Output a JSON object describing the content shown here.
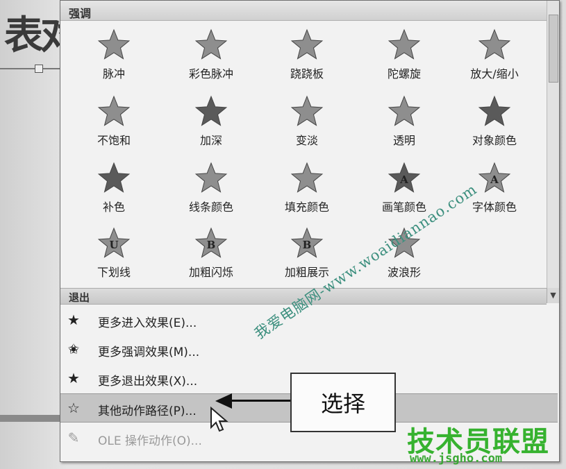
{
  "background": {
    "title_fragment": "表对"
  },
  "menu": {
    "emphasis_header": "强调",
    "effects": [
      {
        "label": "脉冲",
        "icon": "star-pulse-icon",
        "glyph": ""
      },
      {
        "label": "彩色脉冲",
        "icon": "star-color-pulse-icon",
        "glyph": ""
      },
      {
        "label": "跷跷板",
        "icon": "star-teeter-icon",
        "glyph": ""
      },
      {
        "label": "陀螺旋",
        "icon": "star-spin-icon",
        "glyph": ""
      },
      {
        "label": "放大/缩小",
        "icon": "star-grow-shrink-icon",
        "glyph": ""
      },
      {
        "label": "不饱和",
        "icon": "star-desaturate-icon",
        "glyph": ""
      },
      {
        "label": "加深",
        "icon": "star-darken-icon",
        "glyph": ""
      },
      {
        "label": "变淡",
        "icon": "star-lighten-icon",
        "glyph": ""
      },
      {
        "label": "透明",
        "icon": "star-transparency-icon",
        "glyph": ""
      },
      {
        "label": "对象颜色",
        "icon": "star-object-color-icon",
        "glyph": ""
      },
      {
        "label": "补色",
        "icon": "star-complementary-color-icon",
        "glyph": ""
      },
      {
        "label": "线条颜色",
        "icon": "star-line-color-icon",
        "glyph": ""
      },
      {
        "label": "填充颜色",
        "icon": "star-fill-color-icon",
        "glyph": ""
      },
      {
        "label": "画笔颜色",
        "icon": "star-brush-color-icon",
        "glyph": "A"
      },
      {
        "label": "字体颜色",
        "icon": "star-font-color-icon",
        "glyph": "A"
      },
      {
        "label": "下划线",
        "icon": "star-underline-icon",
        "glyph": "U"
      },
      {
        "label": "加粗闪烁",
        "icon": "star-bold-flash-icon",
        "glyph": "B"
      },
      {
        "label": "加粗展示",
        "icon": "star-bold-reveal-icon",
        "glyph": "B"
      },
      {
        "label": "波浪形",
        "icon": "star-wave-icon",
        "glyph": ""
      }
    ],
    "exit_header": "退出",
    "commands": [
      {
        "label": "更多进入效果(E)...",
        "icon": "star-entrance-icon",
        "glyph": "★"
      },
      {
        "label": "更多强调效果(M)...",
        "icon": "star-emphasis-icon",
        "glyph": "✬"
      },
      {
        "label": "更多退出效果(X)...",
        "icon": "star-exit-icon",
        "glyph": "★"
      },
      {
        "label": "其他动作路径(P)...",
        "icon": "star-motion-path-icon",
        "glyph": "☆"
      },
      {
        "label": "OLE 操作动作(O)...",
        "icon": "pencil-icon",
        "glyph": "✎"
      }
    ]
  },
  "callout": {
    "label": "选择"
  },
  "watermark": {
    "url_text": "我爱电脑网-www.woaidiannao.com",
    "site_name": "技术员联盟",
    "domain": "www.jsgho.com"
  }
}
